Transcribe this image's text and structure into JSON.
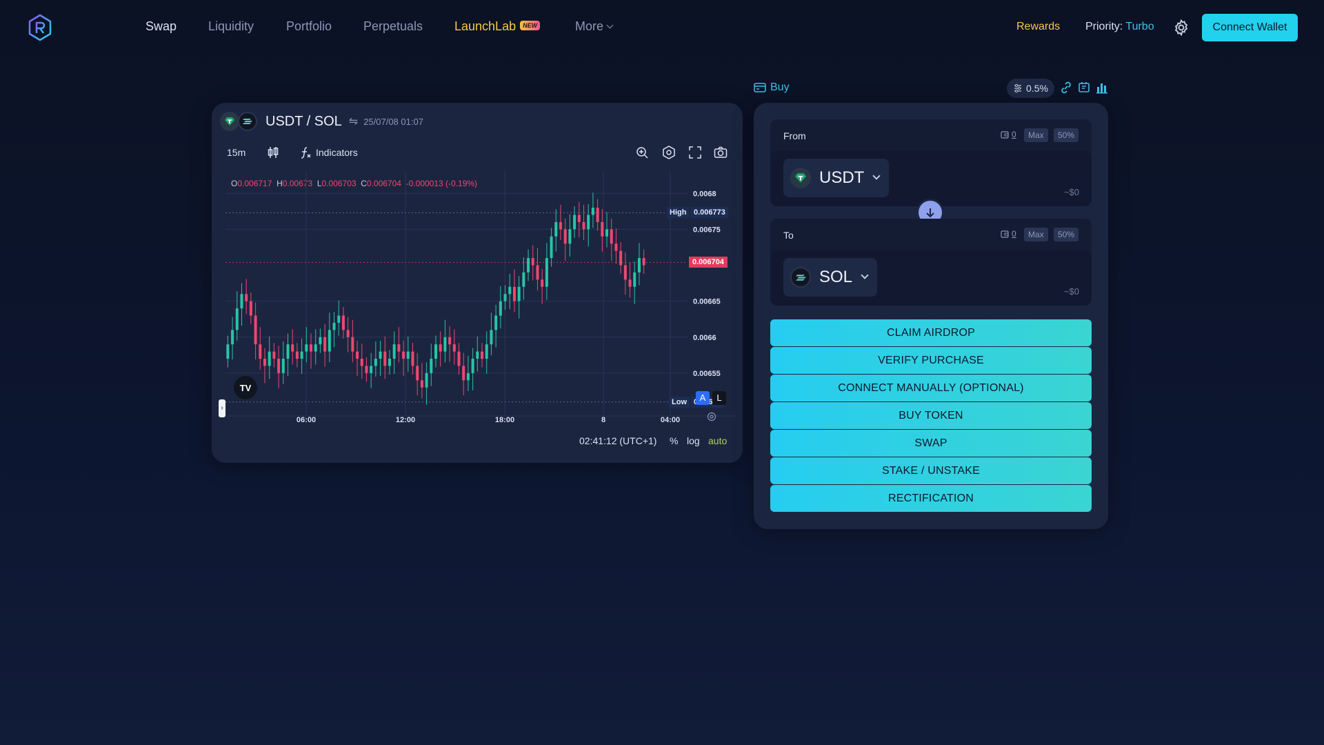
{
  "nav": {
    "items": [
      "Swap",
      "Liquidity",
      "Portfolio",
      "Perpetuals",
      "LaunchLab",
      "More"
    ],
    "new_badge": "NEW",
    "rewards": "Rewards",
    "priority_label": "Priority:",
    "priority_value": "Turbo",
    "connect_wallet": "Connect Wallet"
  },
  "chart": {
    "pair": "USDT / SOL",
    "datetime": "25/07/08 01:07",
    "interval": "15m",
    "indicators": "Indicators",
    "ohlc": {
      "o_label": "O",
      "o": "0.006717",
      "h_label": "H",
      "h": "0.00673",
      "l_label": "L",
      "l": "0.006703",
      "c_label": "C",
      "c": "0.006704",
      "change": "-0.000013 (-0.19%)"
    },
    "high_label": "High",
    "high_value": "0.006773",
    "low_label": "Low",
    "low_value": "0.00651",
    "last_price": "0.006704",
    "status_time": "02:41:12 (UTC+1)",
    "status_pct": "%",
    "status_log": "log",
    "status_auto": "auto",
    "btn_a": "A",
    "btn_l": "L",
    "tv": "TV"
  },
  "chart_data": {
    "type": "candlestick",
    "y_ticks": [
      "0.0068",
      "0.00675",
      "0.00665",
      "0.0066",
      "0.00655"
    ],
    "x_ticks": [
      "06:00",
      "12:00",
      "18:00",
      "8",
      "04:00"
    ],
    "ylim": [
      0.0065,
      0.00683
    ],
    "high": 0.006773,
    "low": 0.00651,
    "last": 0.006704,
    "candles": [
      0.00659,
      0.00661,
      0.00664,
      0.00666,
      0.00665,
      0.00663,
      0.00659,
      0.00657,
      0.00656,
      0.00658,
      0.00657,
      0.00655,
      0.00657,
      0.00659,
      0.00658,
      0.00657,
      0.00658,
      0.00659,
      0.00658,
      0.00659,
      0.0066,
      0.00658,
      0.00661,
      0.00662,
      0.00663,
      0.00661,
      0.0066,
      0.00658,
      0.00657,
      0.00656,
      0.00655,
      0.00656,
      0.00657,
      0.00658,
      0.00656,
      0.00657,
      0.00659,
      0.00658,
      0.00657,
      0.00658,
      0.00656,
      0.00654,
      0.00653,
      0.00655,
      0.00657,
      0.00659,
      0.00658,
      0.0066,
      0.00659,
      0.00658,
      0.00656,
      0.00654,
      0.00655,
      0.00657,
      0.00658,
      0.00657,
      0.00659,
      0.00661,
      0.00663,
      0.00665,
      0.00666,
      0.00667,
      0.00665,
      0.00667,
      0.00669,
      0.00671,
      0.0067,
      0.00668,
      0.00667,
      0.00671,
      0.00674,
      0.00676,
      0.00675,
      0.00673,
      0.00675,
      0.00677,
      0.00676,
      0.00675,
      0.00677,
      0.00678,
      0.00676,
      0.00674,
      0.00675,
      0.00673,
      0.00672,
      0.0067,
      0.00668,
      0.00667,
      0.00669,
      0.00671,
      0.0067
    ]
  },
  "swap": {
    "buy": "Buy",
    "slippage": "0.5%",
    "from_label": "From",
    "to_label": "To",
    "balance": "0",
    "max": "Max",
    "half": "50%",
    "from_token": "USDT",
    "to_token": "SOL",
    "usd_from": "~$0",
    "usd_to": "~$0",
    "actions": [
      "CLAIM AIRDROP",
      "VERIFY PURCHASE",
      "CONNECT MANUALLY (OPTIONAL)",
      "BUY TOKEN",
      "SWAP",
      "STAKE / UNSTAKE",
      "RECTIFICATION"
    ]
  },
  "colors": {
    "accent": "#22d1ee",
    "up": "#26c6a6",
    "down": "#ef476f",
    "panel": "#1c2540"
  }
}
